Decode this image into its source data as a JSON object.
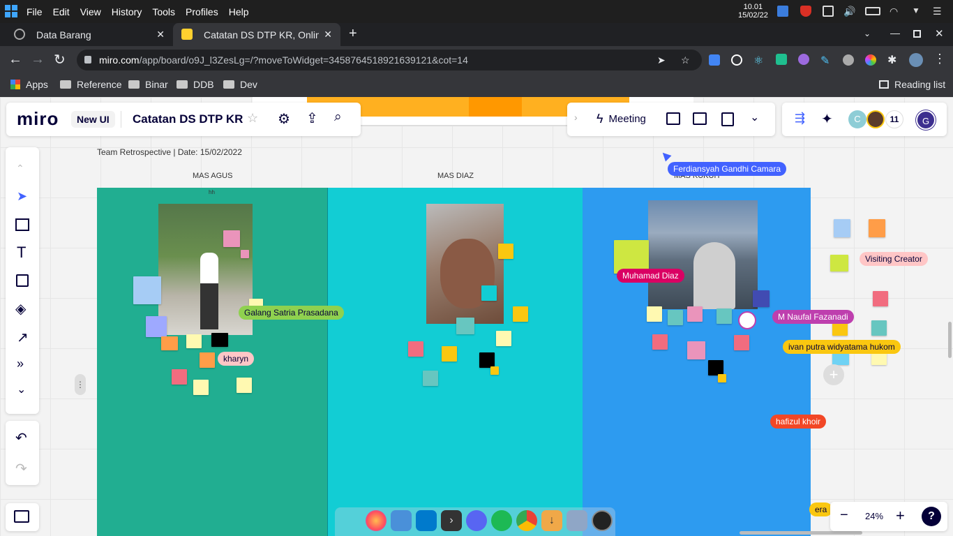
{
  "os": {
    "menu": [
      "File",
      "Edit",
      "View",
      "History",
      "Tools",
      "Profiles",
      "Help"
    ],
    "time": "10.01",
    "date": "15/02/22"
  },
  "tabs": [
    {
      "title": "Data Barang",
      "active": false
    },
    {
      "title": "Catatan DS DTP KR, Online W",
      "active": true
    }
  ],
  "address": {
    "domain": "miro.com",
    "path": "/app/board/o9J_l3ZesLg=/?moveToWidget=3458764518921639121&cot=14"
  },
  "bookmarks": [
    "Apps",
    "Reference",
    "Binar",
    "DDB",
    "Dev"
  ],
  "reading_list": "Reading list",
  "miro": {
    "logo": "miro",
    "new_ui": "New UI",
    "board_title": "Catatan DS DTP KR",
    "meeting": "Meeting",
    "participant_count": "11",
    "avatar_c": "C",
    "avatar_g": "G",
    "zoom": "24%",
    "help": "?"
  },
  "board": {
    "frame_title": "Team Retrospective | Date: 15/02/2022",
    "columns": [
      "MAS AGUS",
      "MAS DIAZ",
      "MAS KUKUH"
    ],
    "small_label": "hh",
    "colors": {
      "col1": "#21ae91",
      "col2": "#12cdd4",
      "col3": "#2d9bf0"
    }
  },
  "cursors": [
    {
      "name": "Ferdiansyah Gandhi Camara",
      "color": "#4262ff"
    },
    {
      "name": "Galang Satria Prasadana",
      "color": "#8fd14f"
    },
    {
      "name": "kharyn",
      "color": "#ffc6c6"
    },
    {
      "name": "Muhamad Diaz",
      "color": "#da0063"
    },
    {
      "name": "M Naufal Fazanadi",
      "color": "#be3fae"
    },
    {
      "name": "ivan putra widyatama hukom",
      "color": "#fac710"
    },
    {
      "name": "hafizul khoir",
      "color": "#f24726"
    },
    {
      "name": "Visiting Creator",
      "color": "#ffc6c6"
    },
    {
      "name": "era",
      "color": "#fac710"
    }
  ]
}
